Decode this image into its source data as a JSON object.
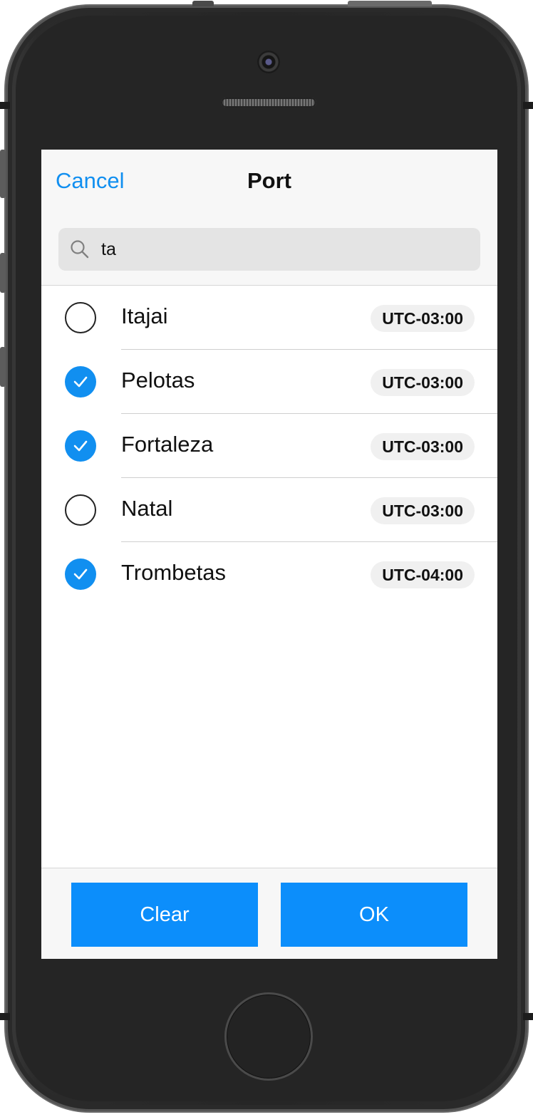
{
  "header": {
    "cancel_label": "Cancel",
    "title": "Port"
  },
  "search": {
    "value": "ta",
    "icon": "search-icon"
  },
  "ports": [
    {
      "name": "Itajai",
      "timezone": "UTC-03:00",
      "selected": false
    },
    {
      "name": "Pelotas",
      "timezone": "UTC-03:00",
      "selected": true
    },
    {
      "name": "Fortaleza",
      "timezone": "UTC-03:00",
      "selected": true
    },
    {
      "name": "Natal",
      "timezone": "UTC-03:00",
      "selected": false
    },
    {
      "name": "Trombetas",
      "timezone": "UTC-04:00",
      "selected": true
    }
  ],
  "footer": {
    "clear_label": "Clear",
    "ok_label": "OK"
  },
  "colors": {
    "accent": "#118ff0",
    "button": "#0c8efb",
    "header_bg": "#f7f7f7",
    "search_bg": "#e4e4e4"
  }
}
